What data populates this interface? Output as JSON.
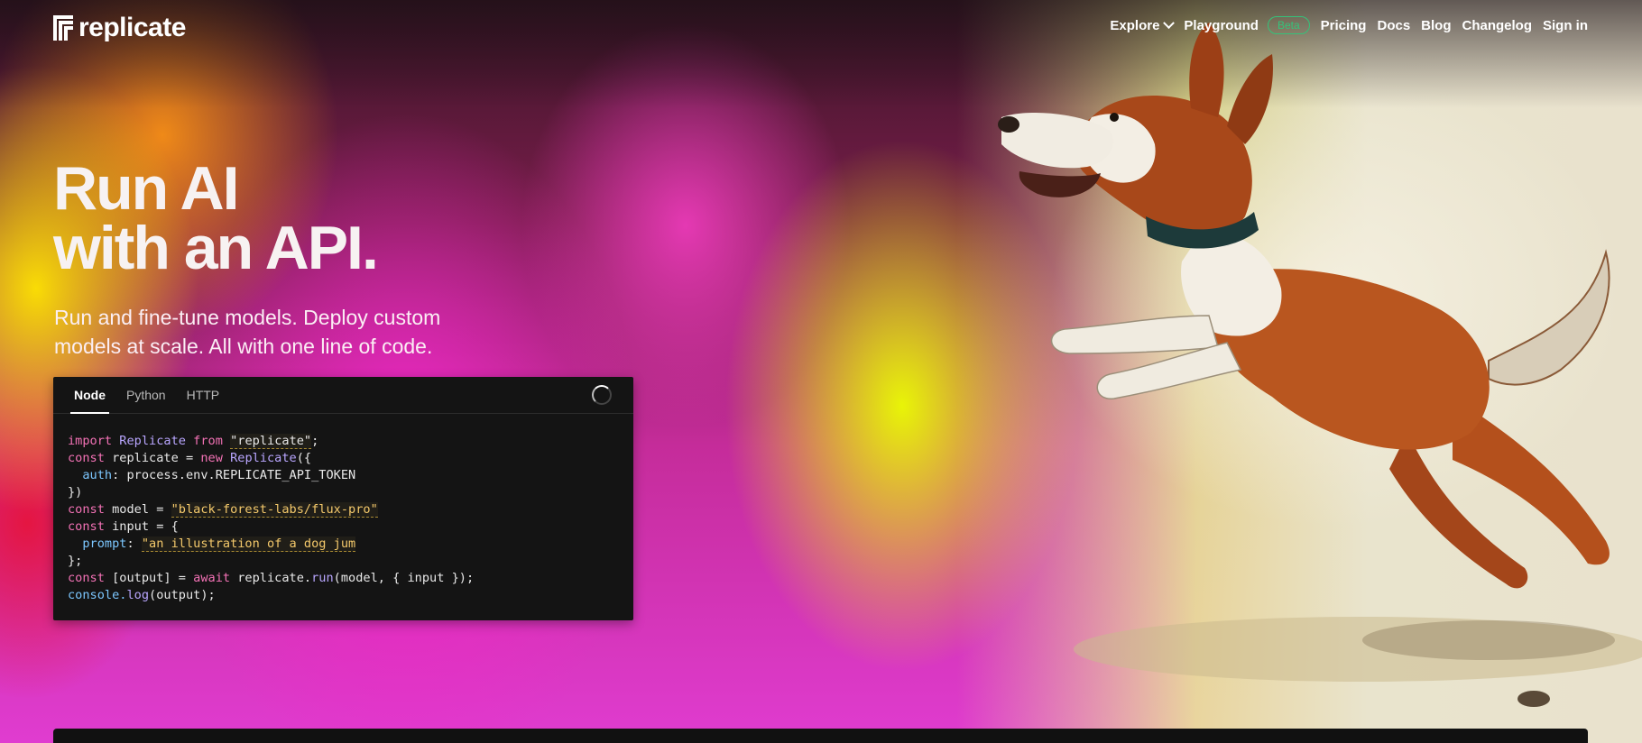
{
  "brand": {
    "name": "replicate"
  },
  "nav": {
    "explore": "Explore",
    "playground": "Playground",
    "beta_badge": "Beta",
    "pricing": "Pricing",
    "docs": "Docs",
    "blog": "Blog",
    "changelog": "Changelog",
    "sign_in": "Sign in"
  },
  "hero": {
    "headline_line1": "Run AI",
    "headline_line2": "with an API.",
    "subtitle_line1": "Run and fine-tune models. Deploy custom",
    "subtitle_line2": "models at scale. All with one line of code."
  },
  "code_panel": {
    "tabs": [
      "Node",
      "Python",
      "HTTP"
    ],
    "active_tab": "Node",
    "lines": {
      "l1_kw1": "import",
      "l1_cls": "Replicate",
      "l1_kw2": "from",
      "l1_str": "\"replicate\"",
      "l1_end": ";",
      "l2_kw1": "const",
      "l2_var": "replicate =",
      "l2_kw2": "new",
      "l2_cls": "Replicate",
      "l2_end": "({",
      "l3_prop": "auth",
      "l3_rest": ": process.env.REPLICATE_API_TOKEN",
      "l4": "})",
      "l5_kw": "const",
      "l5_var": "model =",
      "l5_str": "\"black-forest-labs/flux-pro\"",
      "l6_kw": "const",
      "l6_var": "input = {",
      "l7_prop": "prompt",
      "l7_colon": ":",
      "l7_str": "\"an illustration of a dog jum",
      "l8": "};",
      "l9_kw1": "const",
      "l9_var": "[output] =",
      "l9_kw2": "await",
      "l9_obj": "replicate.",
      "l9_fn": "run",
      "l9_rest": "(model, { input });",
      "l10_obj": "console.",
      "l10_fn": "log",
      "l10_rest": "(output);"
    }
  },
  "colors": {
    "beta_green": "#34c37a",
    "code_bg": "#141414",
    "keyword_pink": "#f472b6",
    "string_yellow": "#f4c96b"
  },
  "icons": {
    "explore_dropdown": "chevron-down-icon",
    "loading": "spinner-icon",
    "logo": "replicate-logo-mark"
  }
}
